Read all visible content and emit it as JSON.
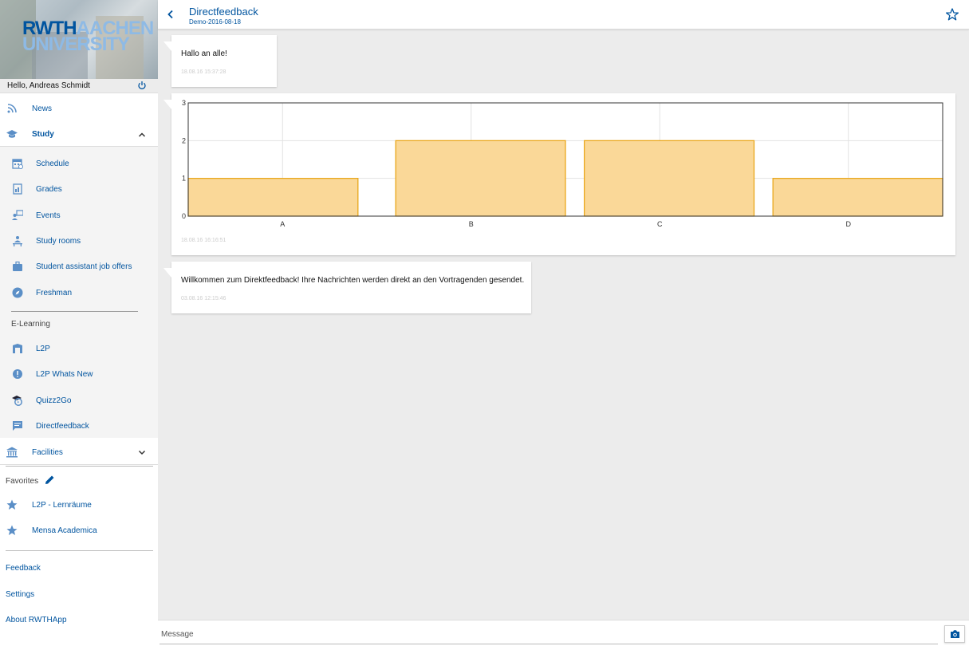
{
  "sidebar": {
    "logo": {
      "line1_a": "RWTH",
      "line1_b": "AACHEN",
      "line2": "UNIVERSITY"
    },
    "greeting": "Hello, Andreas Schmidt",
    "news": "News",
    "study": "Study",
    "study_items": [
      "Schedule",
      "Grades",
      "Events",
      "Study rooms",
      "Student assistant job offers",
      "Freshman"
    ],
    "elearning_label": "E-Learning",
    "elearning_items": [
      "L2P",
      "L2P Whats New",
      "Quizz2Go",
      "Directfeedback"
    ],
    "facilities": "Facilities",
    "favorites_label": "Favorites",
    "favorites": [
      "L2P - Lernräume",
      "Mensa Academica"
    ],
    "footer_links": [
      "Feedback",
      "Settings",
      "About RWTHApp"
    ]
  },
  "topbar": {
    "title": "Directfeedback",
    "subtitle": "Demo-2016-08-18"
  },
  "messages": [
    {
      "text": "Hallo an alle!",
      "time": "18.08.16 15:37:28"
    },
    {
      "text": "",
      "time": "18.08.16 16:16:51"
    },
    {
      "text": "Willkommen zum Direktfeedback! Ihre Nachrichten werden direkt an den Vortragenden gesendet.",
      "time": "03.08.16 12:15:46"
    }
  ],
  "chart_data": {
    "type": "bar",
    "categories": [
      "A",
      "B",
      "C",
      "D"
    ],
    "values": [
      1,
      2,
      2,
      1
    ],
    "ylim": [
      0,
      3
    ],
    "yticks": [
      0,
      1,
      2,
      3
    ],
    "grid": true,
    "bar_color": "#fad898",
    "bar_border": "#e8a310"
  },
  "composer": {
    "placeholder": "Message"
  },
  "colors": {
    "brand": "#00549f",
    "brand_light": "#8ebae5",
    "icon": "#5b8fc7"
  }
}
